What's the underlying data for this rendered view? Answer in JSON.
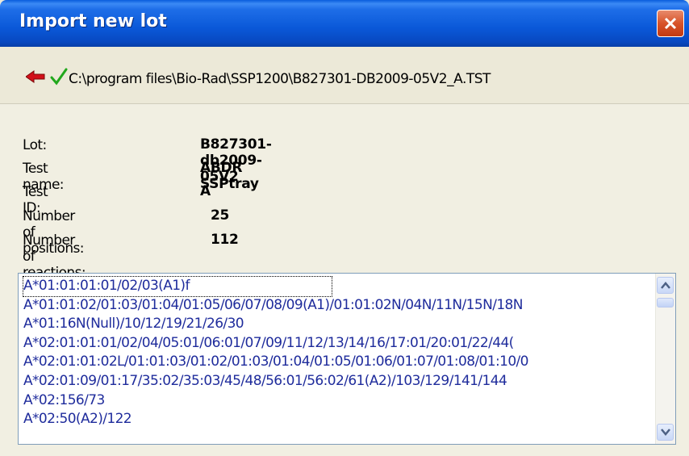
{
  "window": {
    "title": "Import new lot"
  },
  "pathbar": {
    "path": "C:\\program files\\Bio-Rad\\SSP1200\\B827301-DB2009-05V2_A.TST"
  },
  "info": {
    "lot_label": "Lot:",
    "lot_value": "B827301-db2009-05V2",
    "test_name_label": "Test name:",
    "test_name_value": "ABDR SSPtray",
    "test_id_label": "Test ID:",
    "test_id_value": "A",
    "positions_label": "Number of positions:",
    "positions_value": "25",
    "reactions_label": "Number of reactions:",
    "reactions_value": "112"
  },
  "list": {
    "items": [
      "A*01:01:01:01/02/03(A1)f",
      "A*01:01:02/01:03/01:04/01:05/06/07/08/09(A1)/01:01:02N/04N/11N/15N/18N",
      "A*01:16N(Null)/10/12/19/21/26/30",
      "A*02:01:01:01/02/04/05:01/06:01/07/09/11/12/13/14/16/17:01/20:01/22/44(",
      "A*02:01:01:02L/01:01:03/01:02/01:03/01:04/01:05/01:06/01:07/01:08/01:10/0",
      "A*02:01:09/01:17/35:02/35:03/45/48/56:01/56:02/61(A2)/103/129/141/144",
      "A*02:156/73",
      "A*02:50(A2)/122"
    ],
    "selected_index": 0
  },
  "icons": {
    "back": "red-left-arrow-icon",
    "status": "green-check-icon",
    "close": "close-x-icon"
  },
  "colors": {
    "title_bar": "#0a58d8",
    "list_text": "#1f2c9c",
    "close_button": "#d8532a"
  }
}
